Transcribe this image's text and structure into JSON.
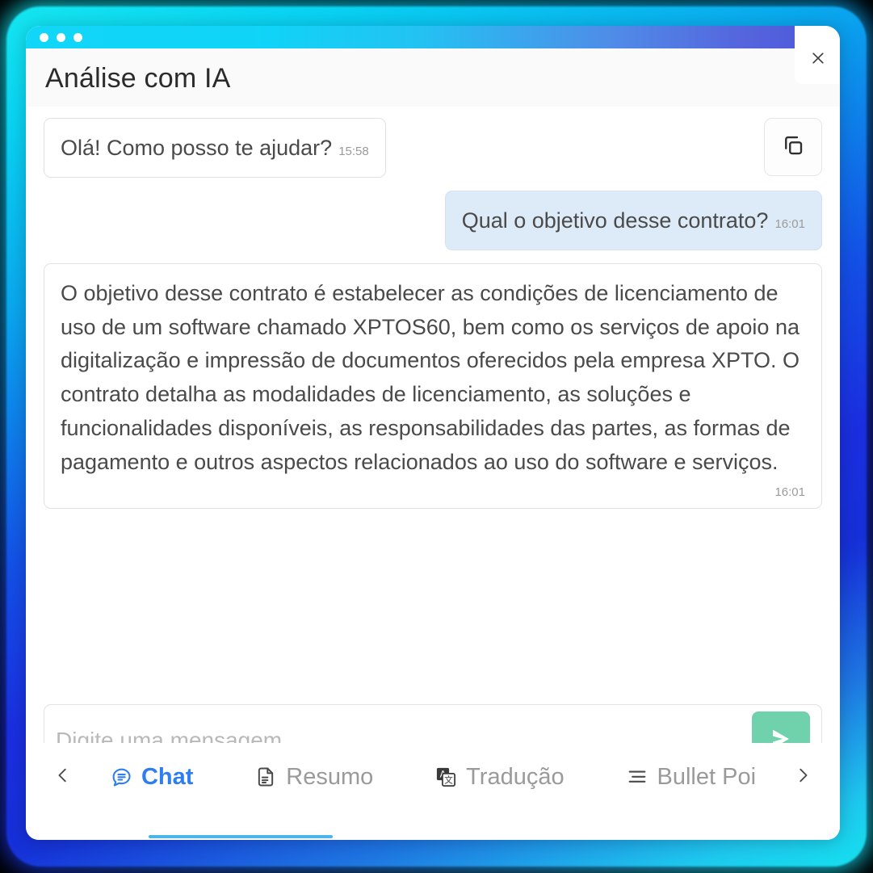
{
  "window": {
    "title": "Análise com IA",
    "traffic_dots": 3,
    "close_icon": "close-icon",
    "accent_cyan": "#12d6f8",
    "accent_blue": "#4b56d8"
  },
  "messages": [
    {
      "role": "bot",
      "text": "Olá! Como posso te ajudar?",
      "time": "15:58"
    },
    {
      "role": "user",
      "text": "Qual o objetivo desse contrato?",
      "time": "16:01"
    },
    {
      "role": "bot",
      "text": "O objetivo desse contrato é estabelecer as condições de licenciamento de uso de um software chamado XPTOS60, bem como os serviços de apoio na digitalização e impressão de documentos oferecidos pela empresa XPTO. O contrato detalha as modalidades de licenciamento, as soluções e funcionalidades disponíveis, as responsabilidades das partes, as formas de pagamento e outros aspectos relacionados ao uso do software e serviços.",
      "time": "16:01"
    }
  ],
  "copy_button": {
    "icon": "copy-icon",
    "label": "Copiar"
  },
  "composer": {
    "placeholder": "Digite uma mensagem",
    "value": "",
    "send_icon": "send-icon",
    "send_color": "#6fd2ad"
  },
  "tabbar": {
    "prev_icon": "chevron-left-icon",
    "next_icon": "chevron-right-icon",
    "active_index": 0,
    "active_color": "#2f7ef0",
    "indicator_color": "#4db3e8",
    "tabs": [
      {
        "label": "Chat",
        "icon": "chat-bubble-icon",
        "active": true
      },
      {
        "label": "Resumo",
        "icon": "document-icon",
        "active": false
      },
      {
        "label": "Tradução",
        "icon": "translate-icon",
        "active": false
      },
      {
        "label": "Bullet Poi",
        "icon": "bullet-list-icon",
        "active": false
      }
    ]
  }
}
